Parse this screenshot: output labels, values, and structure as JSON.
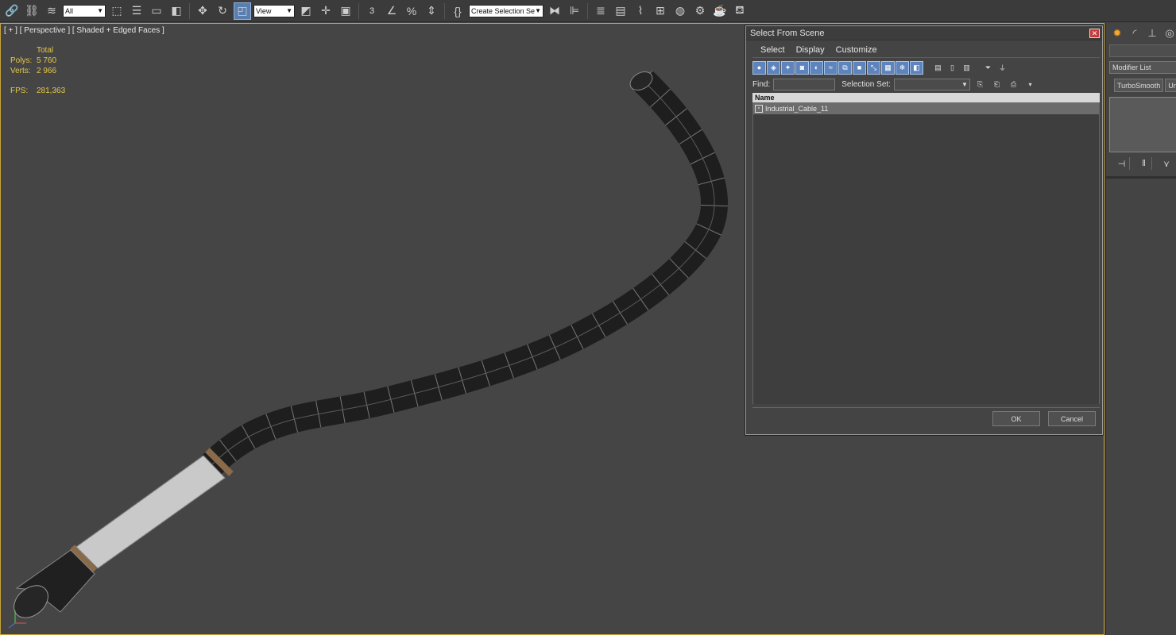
{
  "toolbar": {
    "selection_filter": "All",
    "ref_coord": "View",
    "snap_label": "3",
    "named_selection_placeholder": "Create Selection Se"
  },
  "viewport": {
    "label": "[ + ] [ Perspective ] [ Shaded + Edged Faces ]",
    "stats": {
      "header": "Total",
      "polys_label": "Polys:",
      "polys_value": "5 760",
      "verts_label": "Verts:",
      "verts_value": "2 966",
      "fps_label": "FPS:",
      "fps_value": "281,363"
    }
  },
  "dialog": {
    "title": "Select From Scene",
    "close_glyph": "✕",
    "menu": [
      "Select",
      "Display",
      "Customize"
    ],
    "find_label": "Find:",
    "selection_set_label": "Selection Set:",
    "column_name": "Name",
    "rows": [
      "Industrial_Cable_11"
    ],
    "ok_label": "OK",
    "cancel_label": "Cancel"
  },
  "command_panel": {
    "modifier_list": "Modifier List",
    "modifier_buttons": [
      "TurboSmooth",
      "Unw"
    ]
  },
  "colors": {
    "viewport_border": "#c8a33a",
    "stats_text": "#e4c84a",
    "dialog_toolbar_blue": "#5d84bd"
  }
}
